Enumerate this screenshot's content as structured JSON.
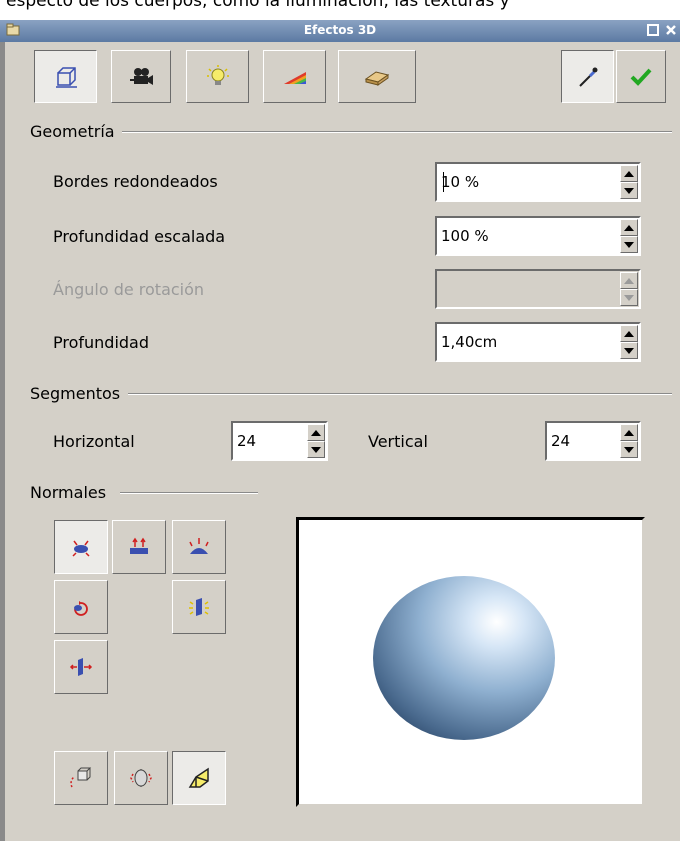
{
  "above_text": "especto de los cuerpos, como la iluminación, las texturas y",
  "window": {
    "title": "Efectos 3D"
  },
  "toolbar": {
    "tabs": [
      {
        "name": "geometry",
        "icon": "geometry-cube-icon",
        "active": true
      },
      {
        "name": "shading",
        "icon": "camera-icon",
        "active": false
      },
      {
        "name": "illumination",
        "icon": "lightbulb-icon",
        "active": false
      },
      {
        "name": "textures",
        "icon": "rainbow-texture-icon",
        "active": false
      },
      {
        "name": "material",
        "icon": "material-bar-icon",
        "active": false
      }
    ],
    "actions": [
      {
        "name": "assign",
        "icon": "eyedropper-icon"
      },
      {
        "name": "apply",
        "icon": "checkmark-icon"
      }
    ]
  },
  "geometry": {
    "heading": "Geometría",
    "fields": {
      "rounded_edges": {
        "label": "Bordes redondeados",
        "value": "10 %"
      },
      "scaled_depth": {
        "label": "Profundidad escalada",
        "value": "100 %"
      },
      "rotation_angle": {
        "label": "Ángulo de rotación",
        "value": "",
        "disabled": true
      },
      "depth": {
        "label": "Profundidad",
        "value": "1,40cm"
      }
    }
  },
  "segments": {
    "heading": "Segmentos",
    "horizontal": {
      "label": "Horizontal",
      "value": "24"
    },
    "vertical": {
      "label": "Vertical",
      "value": "24"
    }
  },
  "normals": {
    "heading": "Normales",
    "buttons": [
      {
        "name": "object-specific",
        "icon": "object-normals-icon",
        "active": true
      },
      {
        "name": "flat",
        "icon": "flat-normals-icon",
        "active": false
      },
      {
        "name": "spherical",
        "icon": "spherical-normals-icon",
        "active": false
      },
      {
        "name": "invert",
        "icon": "invert-normals-icon",
        "active": false
      },
      {
        "name": "double-sided-illumination",
        "icon": "double-sided-illumination-icon",
        "active": false
      },
      {
        "name": "double-sided",
        "icon": "double-sided-icon",
        "active": false
      }
    ]
  },
  "bottom_buttons": [
    {
      "name": "convert-to-3d",
      "icon": "convert-3d-icon",
      "active": false
    },
    {
      "name": "convert-to-lathe",
      "icon": "lathe-object-icon",
      "active": false
    },
    {
      "name": "perspective",
      "icon": "perspective-icon",
      "active": true
    }
  ],
  "preview": {
    "shape": "sphere",
    "color": "#9fc0e0"
  }
}
